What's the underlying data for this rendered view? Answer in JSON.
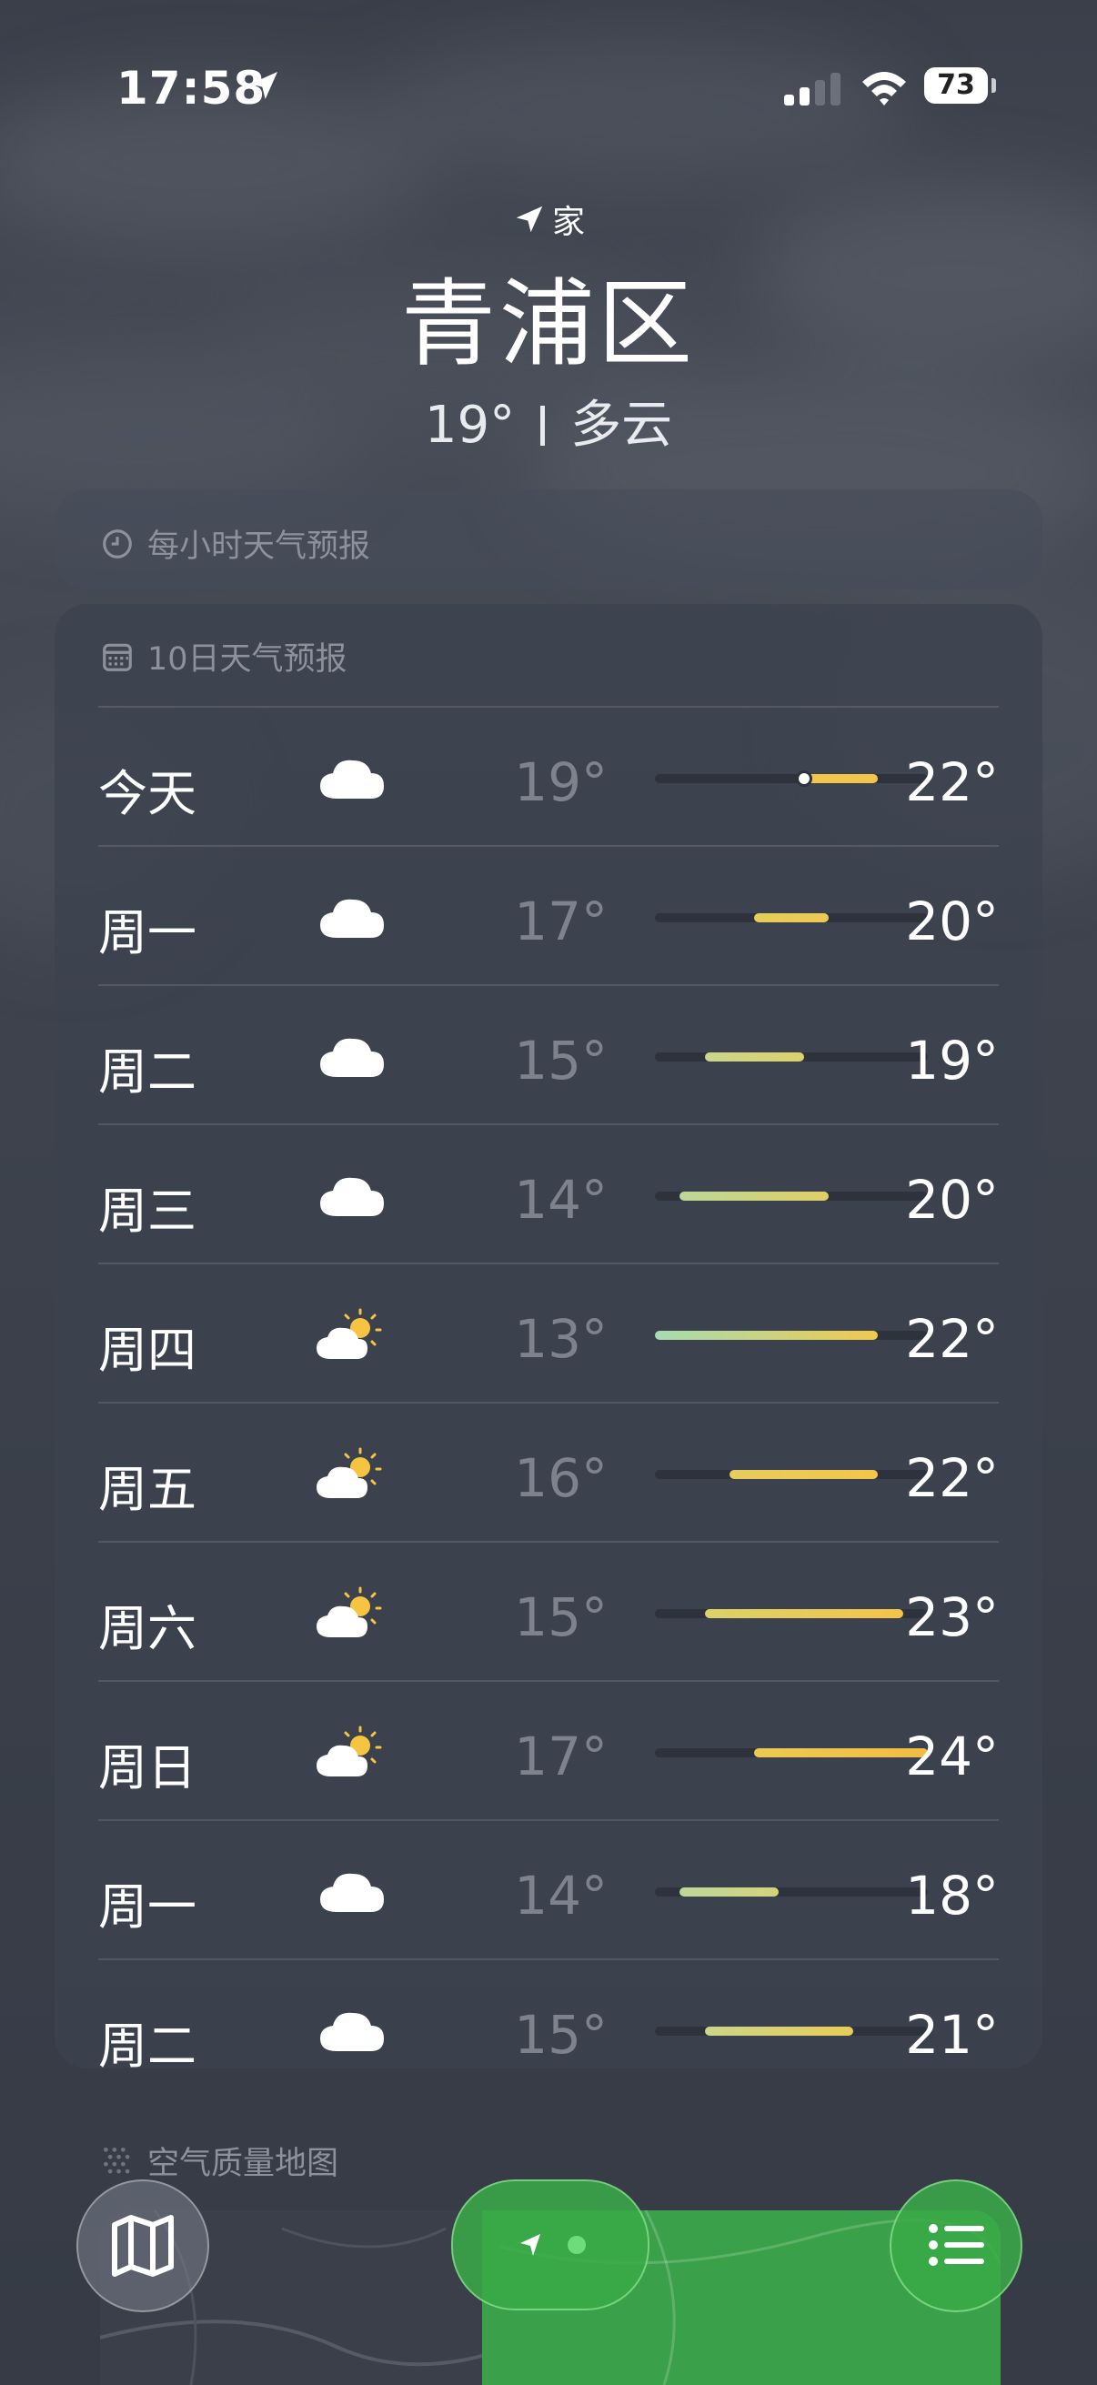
{
  "status_bar": {
    "time": "17:58",
    "battery": "73"
  },
  "header": {
    "home_label": "家",
    "city": "青浦区",
    "temperature": "19°",
    "condition": "多云"
  },
  "hourly_card": {
    "title": "每小时天气预报"
  },
  "daily_card": {
    "title": "10日天气预报",
    "range_min": 13,
    "range_max": 24,
    "days": [
      {
        "day": "今天",
        "icon": "cloud-icon",
        "low": "19°",
        "high": "22°",
        "low_val": 19,
        "high_val": 22,
        "current_val": 19,
        "color_from": "#f3c64b",
        "color_to": "#f3c64b"
      },
      {
        "day": "周一",
        "icon": "cloud-icon",
        "low": "17°",
        "high": "20°",
        "low_val": 17,
        "high_val": 20,
        "color_from": "#e3cf5a",
        "color_to": "#eac953"
      },
      {
        "day": "周二",
        "icon": "cloud-icon",
        "low": "15°",
        "high": "19°",
        "low_val": 15,
        "high_val": 19,
        "color_from": "#cbd68a",
        "color_to": "#dcd16a"
      },
      {
        "day": "周三",
        "icon": "cloud-icon",
        "low": "14°",
        "high": "20°",
        "low_val": 14,
        "high_val": 20,
        "color_from": "#bcd898",
        "color_to": "#dfcf66"
      },
      {
        "day": "周四",
        "icon": "partly-cloudy-icon",
        "low": "13°",
        "high": "22°",
        "low_val": 13,
        "high_val": 22,
        "color_from": "#a6dcb0",
        "color_to": "#f0c94e"
      },
      {
        "day": "周五",
        "icon": "partly-cloudy-icon",
        "low": "16°",
        "high": "22°",
        "low_val": 16,
        "high_val": 22,
        "color_from": "#e6cd5c",
        "color_to": "#f3c64b"
      },
      {
        "day": "周六",
        "icon": "partly-cloudy-icon",
        "low": "15°",
        "high": "23°",
        "low_val": 15,
        "high_val": 23,
        "color_from": "#dcd26a",
        "color_to": "#f3c449"
      },
      {
        "day": "周日",
        "icon": "partly-cloudy-icon",
        "low": "17°",
        "high": "24°",
        "low_val": 17,
        "high_val": 24,
        "color_from": "#eccb52",
        "color_to": "#f1bc44"
      },
      {
        "day": "周一",
        "icon": "cloud-icon",
        "low": "14°",
        "high": "18°",
        "low_val": 14,
        "high_val": 18,
        "color_from": "#bcd898",
        "color_to": "#d4d47a"
      },
      {
        "day": "周二",
        "icon": "cloud-icon",
        "low": "15°",
        "high": "21°",
        "low_val": 15,
        "high_val": 21,
        "color_from": "#cbd68a",
        "color_to": "#e8cc58"
      }
    ]
  },
  "air_quality": {
    "title": "空气质量地图"
  },
  "colors": {
    "accent_green": "#3aa04a",
    "sun_yellow": "#f5c542"
  }
}
